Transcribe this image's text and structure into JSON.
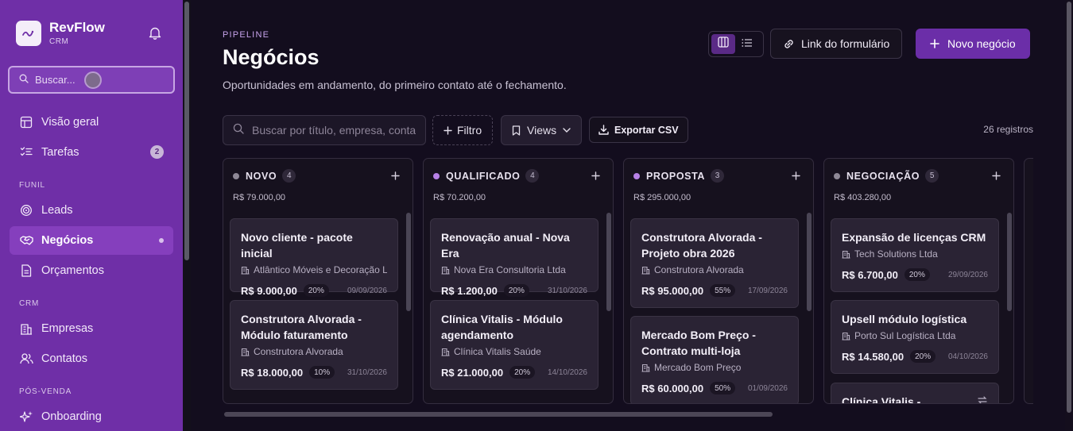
{
  "sidebar": {
    "brand": {
      "name": "RevFlow",
      "sub": "CRM"
    },
    "search_placeholder": "Buscar...",
    "items": [
      {
        "label": "Visão geral",
        "icon": "grid-icon"
      },
      {
        "label": "Tarefas",
        "icon": "checklist-icon",
        "badge": "2"
      },
      {
        "label": "Leads",
        "icon": "target-icon"
      },
      {
        "label": "Negócios",
        "icon": "handshake-icon",
        "active": true
      },
      {
        "label": "Orçamentos",
        "icon": "document-icon"
      },
      {
        "label": "Empresas",
        "icon": "building-icon"
      },
      {
        "label": "Contatos",
        "icon": "users-icon"
      },
      {
        "label": "Onboarding",
        "icon": "sparkles-icon"
      }
    ],
    "sections": [
      "FUNIL",
      "CRM",
      "PÓS-VENDA"
    ]
  },
  "header": {
    "eyebrow": "PIPELINE",
    "title": "Negócios",
    "subtitle": "Oportunidades em andamento, do primeiro contato até o fechamento.",
    "form_link_label": "Link do formulário",
    "new_deal_label": "Novo negócio"
  },
  "toolbar": {
    "search_placeholder": "Buscar por título, empresa, contato...",
    "filter_label": "Filtro",
    "views_label": "Views",
    "export_label": "Exportar CSV",
    "records": "26 registros"
  },
  "colors": {
    "accent": "#6b2ea8",
    "sidebar": "#6f2fa7",
    "background": "#130d1e"
  },
  "columns": [
    {
      "name": "NOVO",
      "count": "4",
      "total": "R$ 79.000,00",
      "dot": "#8e8896",
      "cards": [
        {
          "title": "Novo cliente - pacote inicial",
          "company": "Atlântico Móveis e Decoração Ltda",
          "value": "R$ 9.000,00",
          "prob": "20%",
          "date": "09/09/2026"
        },
        {
          "title": "Construtora Alvorada - Módulo faturamento",
          "company": "Construtora Alvorada",
          "value": "R$ 18.000,00",
          "prob": "10%",
          "date": "31/10/2026"
        }
      ]
    },
    {
      "name": "QUALIFICADO",
      "count": "4",
      "total": "R$ 70.200,00",
      "dot": "#b680e6",
      "cards": [
        {
          "title": "Renovação anual - Nova Era",
          "company": "Nova Era Consultoria Ltda",
          "value": "R$ 1.200,00",
          "prob": "20%",
          "date": "31/10/2026"
        },
        {
          "title": "Clínica Vitalis - Módulo agendamento",
          "company": "Clínica Vitalis Saúde",
          "value": "R$ 21.000,00",
          "prob": "20%",
          "date": "14/10/2026"
        }
      ]
    },
    {
      "name": "PROPOSTA",
      "count": "3",
      "total": "R$ 295.000,00",
      "dot": "#b680e6",
      "cards": [
        {
          "title": "Construtora Alvorada - Projeto obra 2026",
          "company": "Construtora Alvorada",
          "value": "R$ 95.000,00",
          "prob": "55%",
          "date": "17/09/2026"
        },
        {
          "title": "Mercado Bom Preço - Contrato multi-loja",
          "company": "Mercado Bom Preço",
          "value": "R$ 60.000,00",
          "prob": "50%",
          "date": "01/09/2026"
        }
      ]
    },
    {
      "name": "NEGOCIAÇÃO",
      "count": "5",
      "total": "R$ 403.280,00",
      "dot": "#8e8896",
      "cards": [
        {
          "title": "Expansão de licenças CRM",
          "company": "Tech Solutions Ltda",
          "value": "R$ 6.700,00",
          "prob": "20%",
          "date": "29/09/2026"
        },
        {
          "title": "Upsell módulo logística",
          "company": "Porto Sul Logística Ltda",
          "value": "R$ 14.580,00",
          "prob": "20%",
          "date": "04/10/2026"
        },
        {
          "title": "Clínica Vitalis -",
          "company": "",
          "value": "",
          "prob": "",
          "date": ""
        }
      ]
    }
  ]
}
